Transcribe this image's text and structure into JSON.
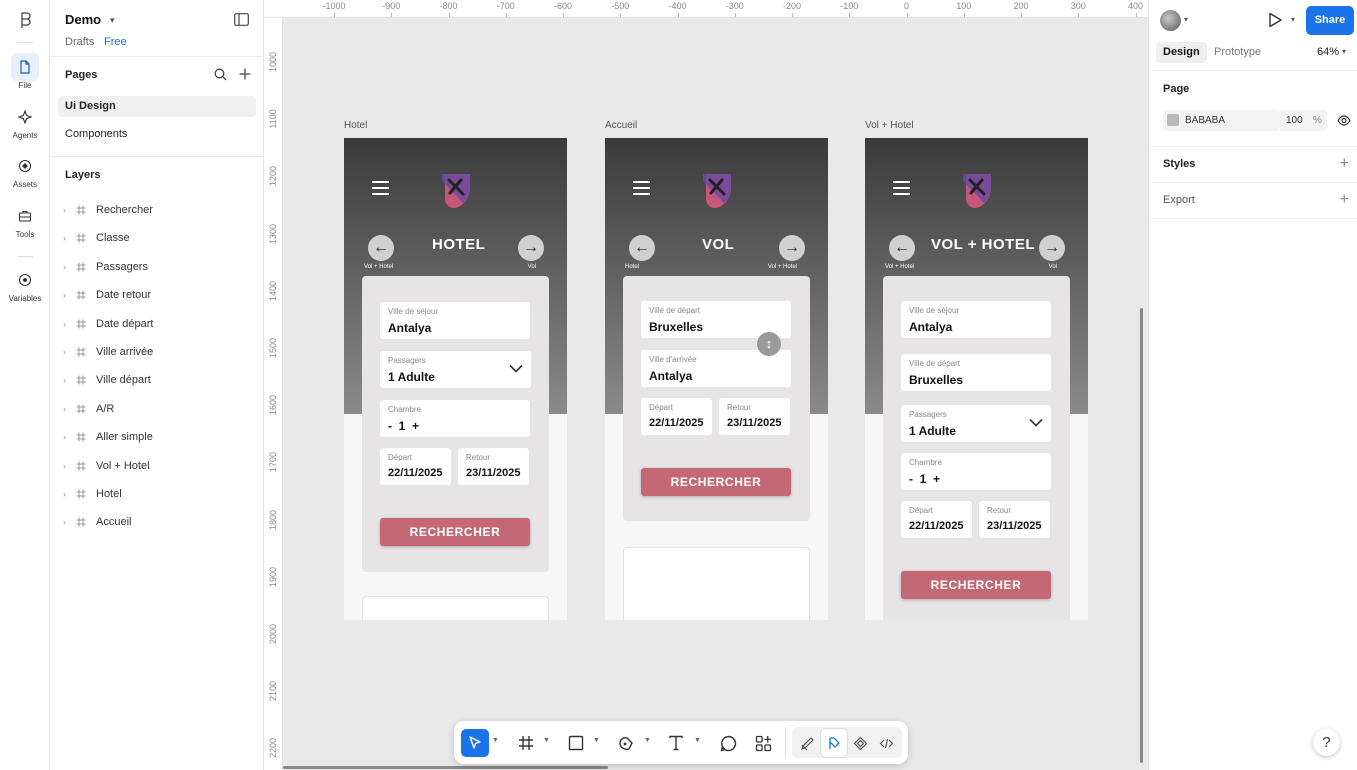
{
  "app": {
    "project_name": "Demo",
    "drafts_label": "Drafts",
    "plan_label": "Free"
  },
  "rail": {
    "items": [
      {
        "label": "File",
        "icon": "file-icon"
      },
      {
        "label": "Agents",
        "icon": "agents-icon"
      },
      {
        "label": "Assets",
        "icon": "assets-icon"
      },
      {
        "label": "Tools",
        "icon": "tools-icon"
      },
      {
        "label": "Variables",
        "icon": "variables-icon"
      }
    ]
  },
  "pages": {
    "title": "Pages",
    "items": [
      "Ui Design",
      "Components"
    ],
    "selected": "Ui Design"
  },
  "layers": {
    "title": "Layers",
    "items": [
      "Rechercher",
      "Classe",
      "Passagers",
      "Date retour",
      "Date départ",
      "Ville arrivée",
      "Ville départ",
      "A/R",
      "Aller simple",
      "Vol + Hotel",
      "Hotel",
      "Accueil"
    ]
  },
  "ruler": {
    "top": [
      "-1000",
      "-900",
      "-800",
      "-700",
      "-600",
      "-500",
      "-400",
      "-300",
      "-200",
      "-100",
      "0",
      "100",
      "200",
      "300",
      "400"
    ],
    "left": [
      "1000",
      "1100",
      "1200",
      "1300",
      "1400",
      "1500",
      "1600",
      "1700",
      "1800",
      "1900",
      "2000",
      "2100",
      "2200"
    ]
  },
  "frames": [
    {
      "label": "Hotel",
      "title": "HOTEL",
      "left_hint": "Vol + Hotel",
      "right_hint": "Vol",
      "fields": [
        {
          "label": "Ville de séjour",
          "value": "Antalya"
        },
        {
          "label": "Passagers",
          "value": "1 Adulte"
        },
        {
          "label": "Chambre",
          "value": "-  1  +"
        }
      ],
      "dates": [
        {
          "label": "Départ",
          "value": "22/11/2025"
        },
        {
          "label": "Retour",
          "value": "23/11/2025"
        }
      ],
      "button": "RECHERCHER"
    },
    {
      "label": "Accueil",
      "title": "VOL",
      "left_hint": "Hotel",
      "right_hint": "Vol + Hotel",
      "fields": [
        {
          "label": "Ville de départ",
          "value": "Bruxelles"
        },
        {
          "label": "Ville d'arrivée",
          "value": "Antalya"
        }
      ],
      "dates": [
        {
          "label": "Départ",
          "value": "22/11/2025"
        },
        {
          "label": "Retour",
          "value": "23/11/2025"
        }
      ],
      "button": "RECHERCHER"
    },
    {
      "label": "Vol + Hotel",
      "title": "VOL + HOTEL",
      "left_hint": "Vol + Hotel",
      "right_hint": "Vol",
      "fields": [
        {
          "label": "Ville de séjour",
          "value": "Antalya"
        },
        {
          "label": "Ville de départ",
          "value": "Bruxelles"
        },
        {
          "label": "Passagers",
          "value": "1 Adulte"
        },
        {
          "label": "Chambre",
          "value": "-  1  +"
        }
      ],
      "dates": [
        {
          "label": "Départ",
          "value": "22/11/2025"
        },
        {
          "label": "Retour",
          "value": "23/11/2025"
        }
      ],
      "button": "RECHERCHER"
    }
  ],
  "right_panel": {
    "share_label": "Share",
    "tabs": [
      "Design",
      "Prototype"
    ],
    "zoom": "64%",
    "page_title": "Page",
    "page_color": "BABABA",
    "opacity": "100",
    "opacity_unit": "%",
    "styles_title": "Styles",
    "export_title": "Export"
  },
  "colors": {
    "accent": "#1a73e8",
    "button": "#c46876",
    "page_bg": "#bababa"
  },
  "help_label": "?"
}
